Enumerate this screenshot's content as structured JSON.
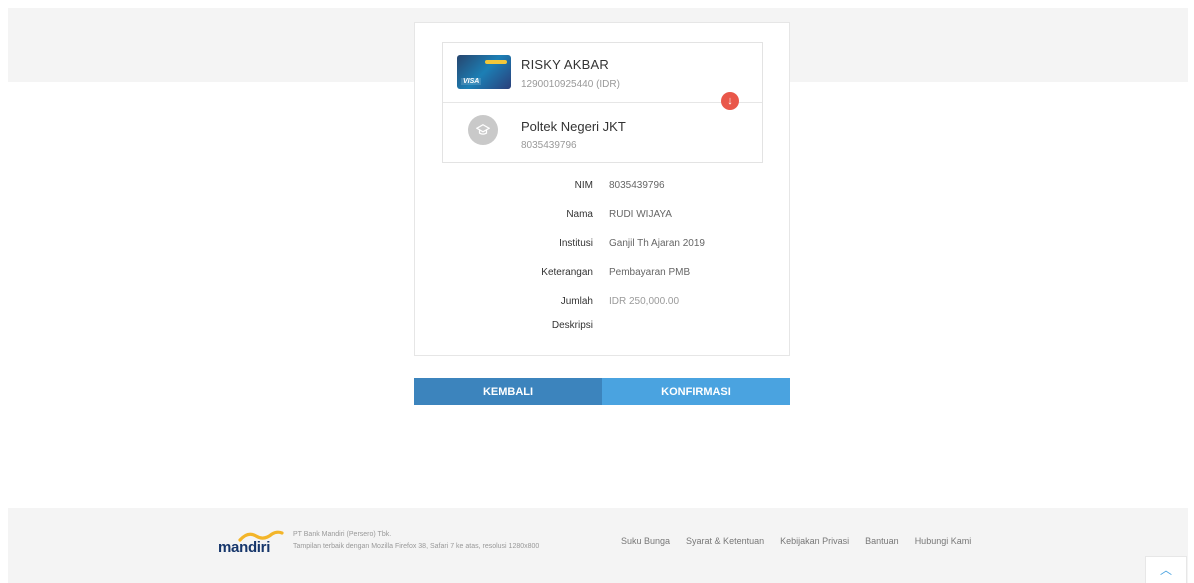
{
  "transfer": {
    "source": {
      "name": "RISKY AKBAR",
      "account": "1290010925440 (IDR)",
      "card_brand": "VISA"
    },
    "destination": {
      "name": "Poltek Negeri JKT",
      "account": "8035439796",
      "icon": "graduation-cap-icon"
    },
    "direction_icon": "arrow-down-icon"
  },
  "details": [
    {
      "label": "NIM",
      "value": "8035439796"
    },
    {
      "label": "Nama",
      "value": "RUDI WIJAYA"
    },
    {
      "label": "Institusi",
      "value": "Ganjil Th Ajaran 2019"
    },
    {
      "label": "Keterangan",
      "value": "Pembayaran PMB"
    },
    {
      "label": "Jumlah",
      "value": "IDR  250,000.00"
    },
    {
      "label": "Deskripsi",
      "value": ""
    }
  ],
  "actions": {
    "back_label": "KEMBALI",
    "confirm_label": "KONFIRMASI"
  },
  "footer": {
    "logo_text": "mandiri",
    "company": "PT Bank Mandiri (Persero) Tbk.",
    "note": "Tampilan terbaik dengan Mozilla Firefox 38, Safari 7 ke atas, resolusi 1280x800",
    "links": [
      "Suku Bunga",
      "Syarat & Ketentuan",
      "Kebijakan Privasi",
      "Bantuan",
      "Hubungi Kami"
    ]
  },
  "colors": {
    "back_button": "#3c84bd",
    "confirm_button": "#4aa3e0",
    "alert_badge": "#e9574a",
    "brand_navy": "#16366b",
    "brand_gold": "#f3b529"
  }
}
